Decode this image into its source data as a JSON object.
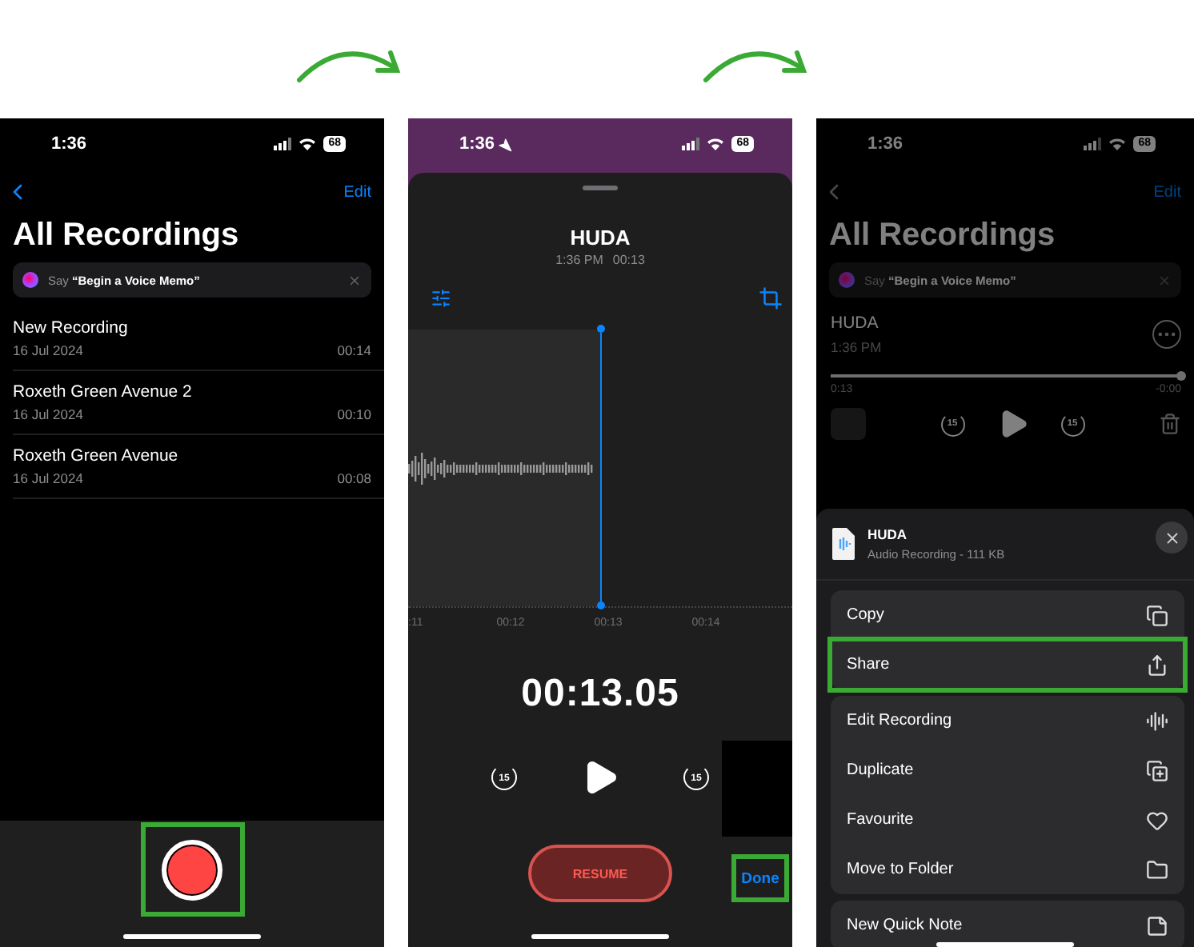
{
  "screens": [
    {
      "kind": "recordings",
      "status": {
        "time": "1:36",
        "battery": "68"
      },
      "nav": {
        "action": "Edit"
      },
      "title": "All Recordings",
      "siri_hint": "Say **“Begin a Voice Memo”**",
      "recordings": [
        {
          "name": "New Recording",
          "date": "16 Jul 2024",
          "duration": "00:14"
        },
        {
          "name": "Roxeth Green Avenue 2",
          "date": "16 Jul 2024",
          "duration": "00:10"
        },
        {
          "name": "Roxeth Green Avenue",
          "date": "16 Jul 2024",
          "duration": "00:08"
        }
      ],
      "record_button": {
        "highlighted": true
      }
    },
    {
      "kind": "editor",
      "status": {
        "time": "1:36",
        "battery": "68"
      },
      "title": "HUDA",
      "time": "1:36 PM",
      "duration": "00:13",
      "ticks": [
        ":11",
        "00:12",
        "00:13",
        "00:14"
      ],
      "timer": "00:13.05",
      "skip_back": "15",
      "skip_forward": "15",
      "resume": "RESUME",
      "done": {
        "label": "Done",
        "highlighted": true
      }
    },
    {
      "kind": "share",
      "status": {
        "time": "1:36",
        "battery": "68"
      },
      "nav": {
        "action": "Edit"
      },
      "title": "All Recordings",
      "siri_hint": "Say **“Begin a Voice Memo”**",
      "recording": {
        "name": "HUDA",
        "time": "1:36 PM",
        "level": 1,
        "elapsed": "0:13",
        "remaining": "-0:00",
        "skip_back": "15",
        "skip_forward": "15"
      },
      "sheet": {
        "file_name": "HUDA",
        "file_info": "Audio Recording - 111 KB",
        "groups": [
          {
            "items": [
              {
                "label": "Copy",
                "highlighted": false
              },
              {
                "label": "Share",
                "highlighted": true
              }
            ]
          },
          {
            "items": [
              {
                "label": "Edit Recording",
                "highlighted": false
              },
              {
                "label": "Duplicate",
                "highlighted": false
              },
              {
                "label": "Favourite",
                "highlighted": false
              },
              {
                "label": "Move to Folder",
                "highlighted": false
              }
            ]
          },
          {
            "items": [
              {
                "label": "New Quick Note",
                "highlighted": false
              }
            ]
          }
        ]
      }
    }
  ]
}
